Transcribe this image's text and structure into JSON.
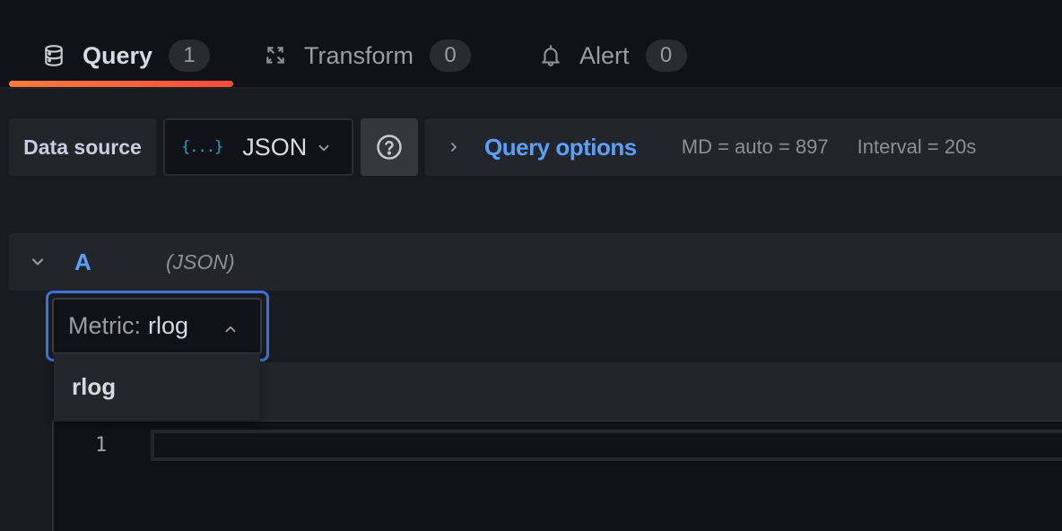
{
  "tabs": [
    {
      "label": "Query",
      "count": "1",
      "icon": "database-icon",
      "active": true
    },
    {
      "label": "Transform",
      "count": "0",
      "icon": "transform-icon",
      "active": false
    },
    {
      "label": "Alert",
      "count": "0",
      "icon": "bell-icon",
      "active": false
    }
  ],
  "colors": {
    "accent_blue": "#5b9ff8",
    "active_tab_gradient_start": "#ff7a3b",
    "active_tab_gradient_end": "#f84b3c",
    "focus_ring": "#3d71d9",
    "json_icon": "#1ba4c4"
  },
  "datasource": {
    "label": "Data source",
    "selected": "JSON",
    "icon": "{...}"
  },
  "query_options": {
    "title": "Query options",
    "max_data_points": "MD = auto = 897",
    "interval": "Interval = 20s"
  },
  "query": {
    "ref_id": "A",
    "datasource_name": "(JSON)",
    "metric_label": "Metric:",
    "metric_value": "rlog",
    "metric_options": [
      "rlog"
    ]
  },
  "editor": {
    "line_numbers": [
      "1"
    ]
  }
}
